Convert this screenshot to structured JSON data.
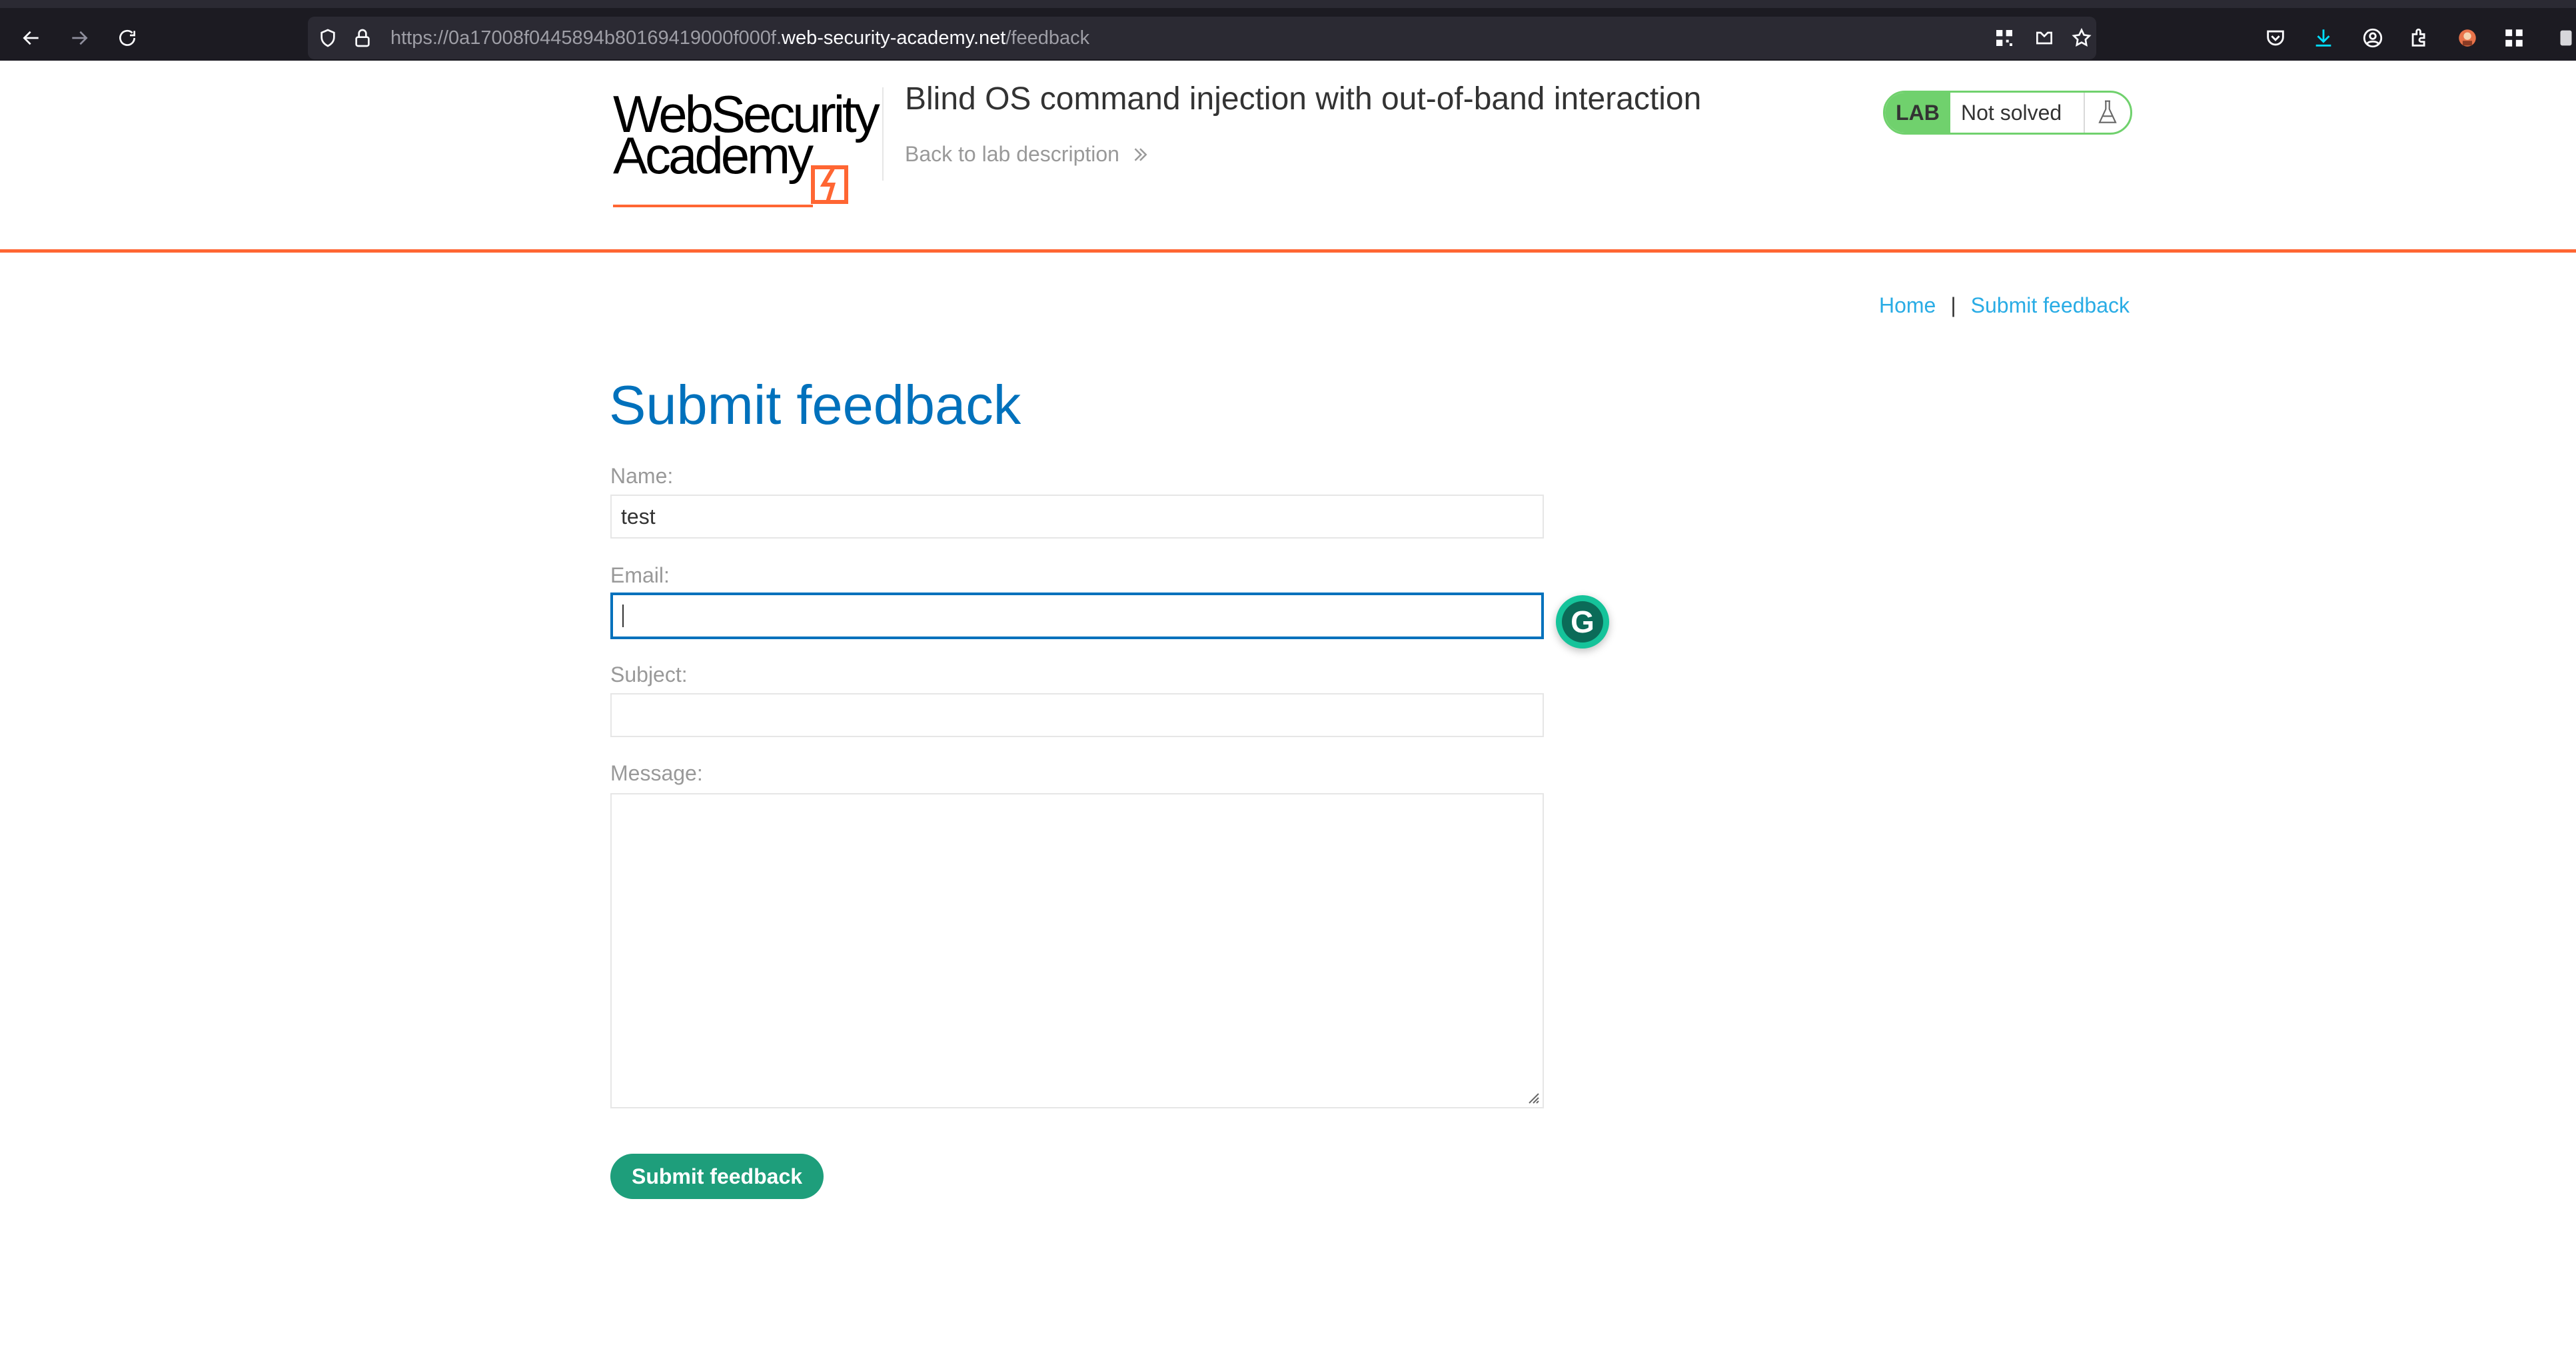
{
  "browser": {
    "url_prefix": "https://0a17008f0445894b80169419000f000f.",
    "url_host": "web-security-academy.net",
    "url_path": "/feedback"
  },
  "header": {
    "logo_line1": "WebSecurity",
    "logo_line2": "Academy",
    "lab_title": "Blind OS command injection with out-of-band interaction",
    "back_link": "Back to lab description",
    "lab_badge": "LAB",
    "lab_status": "Not solved"
  },
  "breadcrumbs": {
    "home": "Home",
    "separator": "|",
    "current": "Submit feedback"
  },
  "form": {
    "title": "Submit feedback",
    "name_label": "Name:",
    "name_value": "test",
    "email_label": "Email:",
    "email_value": "",
    "subject_label": "Subject:",
    "subject_value": "",
    "message_label": "Message:",
    "message_value": "",
    "submit_label": "Submit feedback"
  },
  "colors": {
    "accent_orange": "#ff6633",
    "title_blue": "#0071bc",
    "link_blue": "#29ace5",
    "lab_green": "#70d16d",
    "button_green": "#1e9e7b"
  }
}
